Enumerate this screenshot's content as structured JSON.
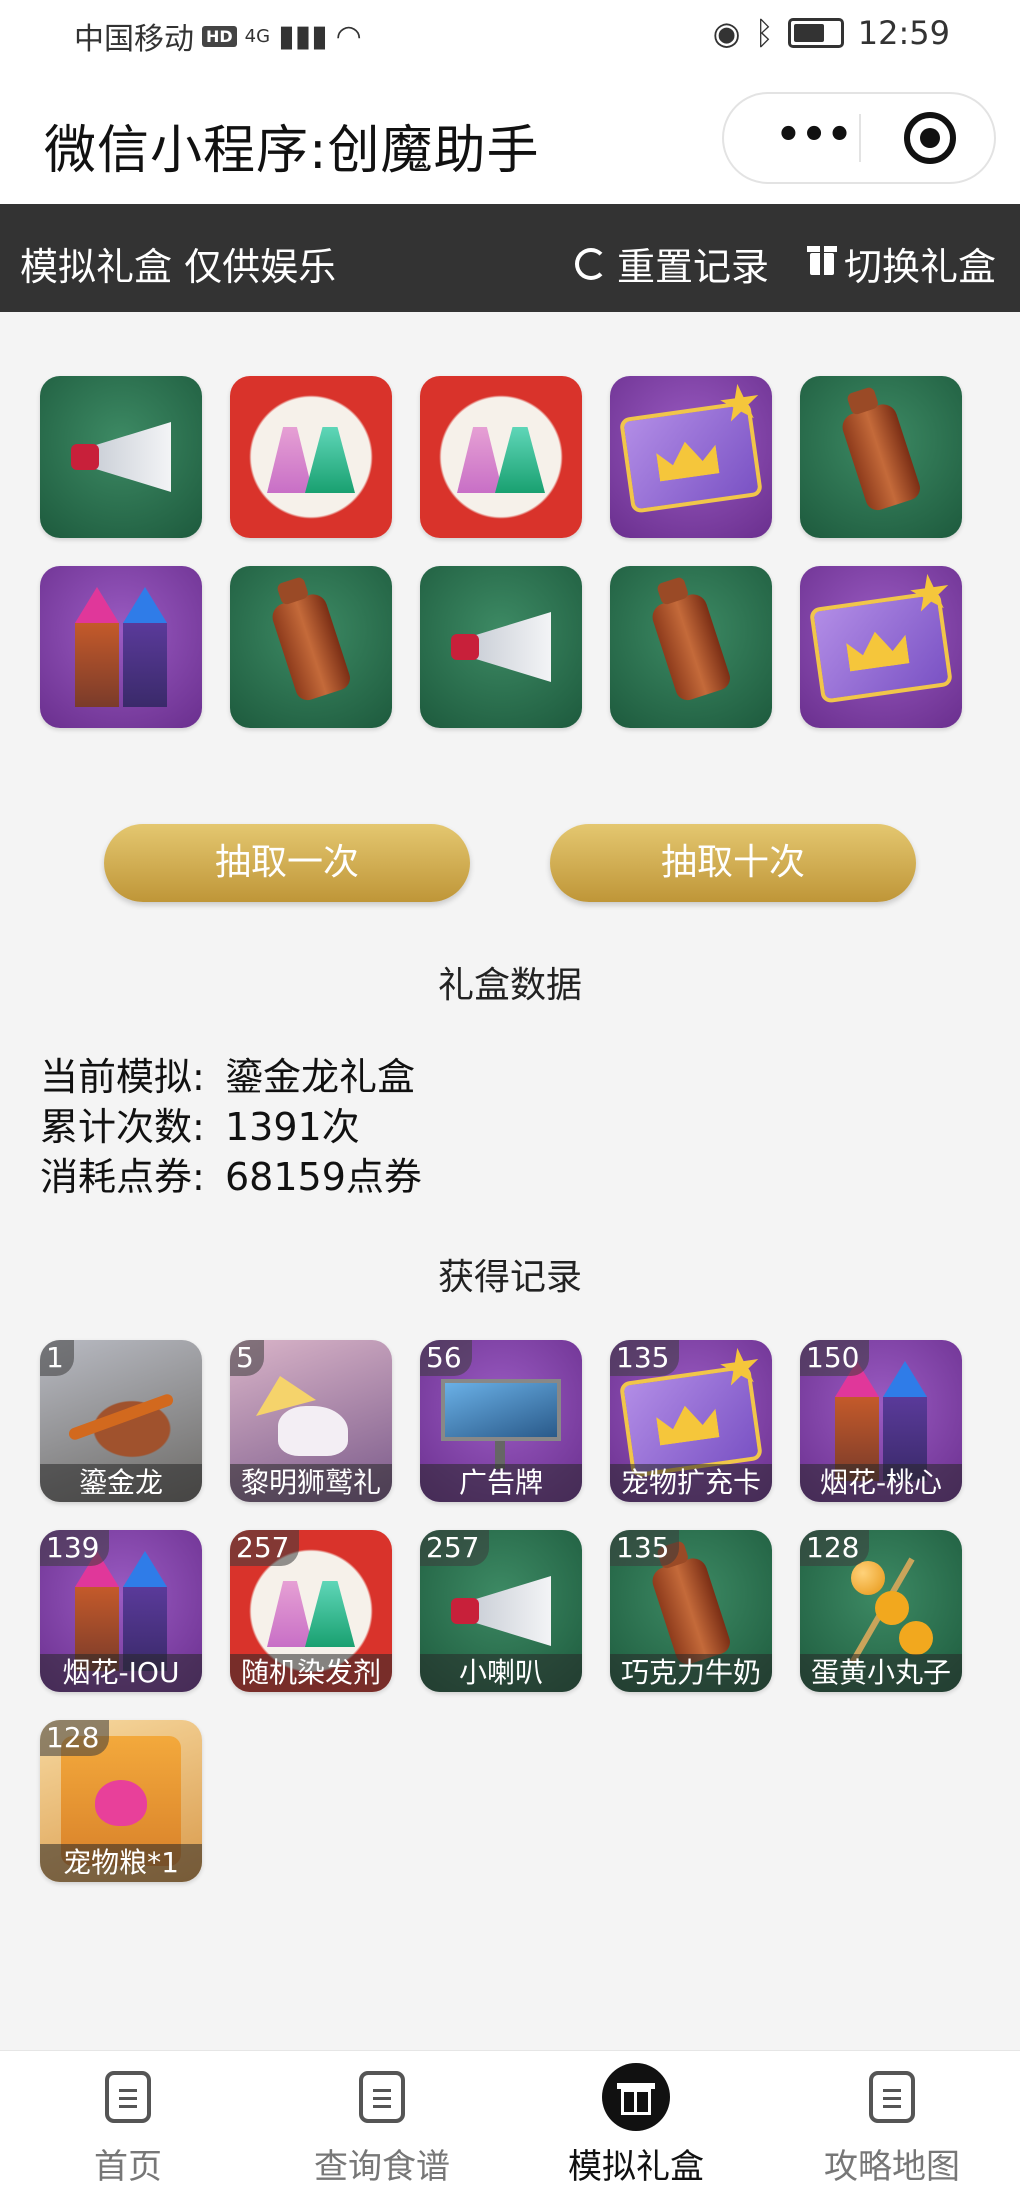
{
  "status_bar": {
    "carrier": "中国移动",
    "hd": "HD",
    "network": "4G",
    "time": "12:59"
  },
  "nav": {
    "title": "微信小程序:创魔助手",
    "more_icon": "more-dots-icon",
    "close_icon": "target-circle-icon"
  },
  "toolbar": {
    "title": "模拟礼盒 仅供娱乐",
    "reset_label": "重置记录",
    "switch_label": "切换礼盒",
    "reset_icon": "refresh-icon",
    "switch_icon": "gift-icon"
  },
  "draw_results": [
    {
      "item": "megaphone",
      "bg": "green"
    },
    {
      "item": "dresses",
      "bg": "red"
    },
    {
      "item": "dresses",
      "bg": "red"
    },
    {
      "item": "card",
      "bg": "purple"
    },
    {
      "item": "bottle",
      "bg": "green"
    },
    {
      "item": "rockets",
      "bg": "purple"
    },
    {
      "item": "bottle",
      "bg": "green"
    },
    {
      "item": "megaphone",
      "bg": "green"
    },
    {
      "item": "bottle",
      "bg": "green"
    },
    {
      "item": "card",
      "bg": "purple"
    }
  ],
  "buttons": {
    "draw_once": "抽取一次",
    "draw_ten": "抽取十次"
  },
  "stats": {
    "section_title": "礼盒数据",
    "rows": [
      {
        "label": "当前模拟:",
        "value": "鎏金龙礼盒"
      },
      {
        "label": "累计次数:",
        "value": "1391次"
      },
      {
        "label": "消耗点券:",
        "value": "68159点券"
      }
    ]
  },
  "records": {
    "section_title": "获得记录",
    "items": [
      {
        "count": "1",
        "name": "鎏金龙",
        "item": "dragon",
        "bg": "grey"
      },
      {
        "count": "5",
        "name": "黎明狮鹫礼",
        "item": "pegasus",
        "bg": "pink"
      },
      {
        "count": "56",
        "name": "广告牌",
        "item": "billboard",
        "bg": "purple"
      },
      {
        "count": "135",
        "name": "宠物扩充卡",
        "item": "card",
        "bg": "purple"
      },
      {
        "count": "150",
        "name": "烟花-桃心",
        "item": "rockets",
        "bg": "purple"
      },
      {
        "count": "139",
        "name": "烟花-IOU",
        "item": "rockets",
        "bg": "purple"
      },
      {
        "count": "257",
        "name": "随机染发剂",
        "item": "dresses",
        "bg": "red"
      },
      {
        "count": "257",
        "name": "小喇叭",
        "item": "megaphone",
        "bg": "green"
      },
      {
        "count": "135",
        "name": "巧克力牛奶",
        "item": "bottle",
        "bg": "green"
      },
      {
        "count": "128",
        "name": "蛋黄小丸子",
        "item": "skewer",
        "bg": "green"
      },
      {
        "count": "128",
        "name": "宠物粮*1",
        "item": "petfood",
        "bg": "amber"
      }
    ]
  },
  "tabbar": {
    "tabs": [
      {
        "label": "首页",
        "icon": "document-icon"
      },
      {
        "label": "查询食谱",
        "icon": "document-icon"
      },
      {
        "label": "模拟礼盒",
        "icon": "gift-icon",
        "active": true
      },
      {
        "label": "攻略地图",
        "icon": "document-icon"
      }
    ]
  }
}
